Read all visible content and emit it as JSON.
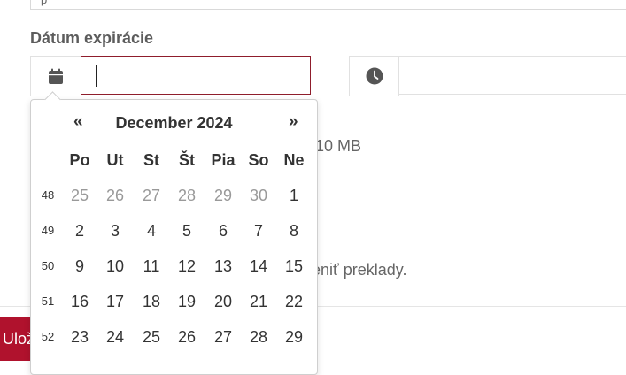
{
  "field": {
    "label": "Dátum expirácie",
    "date_value": "",
    "time_value": ""
  },
  "prev_field_text": "p",
  "background": {
    "size_fragment": "10 MB",
    "translations_fragment": "eniť preklady.",
    "save_fragment": "Ulož"
  },
  "calendar": {
    "month_title": "December 2024",
    "prev": "«",
    "next": "»",
    "weekdays": [
      "Po",
      "Ut",
      "St",
      "Št",
      "Pia",
      "So",
      "Ne"
    ],
    "weeks": [
      {
        "week": "48",
        "days": [
          "25",
          "26",
          "27",
          "28",
          "29",
          "30",
          "1"
        ],
        "muted": [
          true,
          true,
          true,
          true,
          true,
          true,
          false
        ]
      },
      {
        "week": "49",
        "days": [
          "2",
          "3",
          "4",
          "5",
          "6",
          "7",
          "8"
        ],
        "muted": [
          false,
          false,
          false,
          false,
          false,
          false,
          false
        ]
      },
      {
        "week": "50",
        "days": [
          "9",
          "10",
          "11",
          "12",
          "13",
          "14",
          "15"
        ],
        "muted": [
          false,
          false,
          false,
          false,
          false,
          false,
          false
        ]
      },
      {
        "week": "51",
        "days": [
          "16",
          "17",
          "18",
          "19",
          "20",
          "21",
          "22"
        ],
        "muted": [
          false,
          false,
          false,
          false,
          false,
          false,
          false
        ]
      },
      {
        "week": "52",
        "days": [
          "23",
          "24",
          "25",
          "26",
          "27",
          "28",
          "29"
        ],
        "muted": [
          false,
          false,
          false,
          false,
          false,
          false,
          false
        ]
      }
    ]
  },
  "icons": {
    "calendar": "calendar-icon",
    "clock": "clock-icon"
  },
  "colors": {
    "accent_border": "#8f1d2c",
    "save_button": "#b0122d",
    "muted_day": "#999999"
  }
}
